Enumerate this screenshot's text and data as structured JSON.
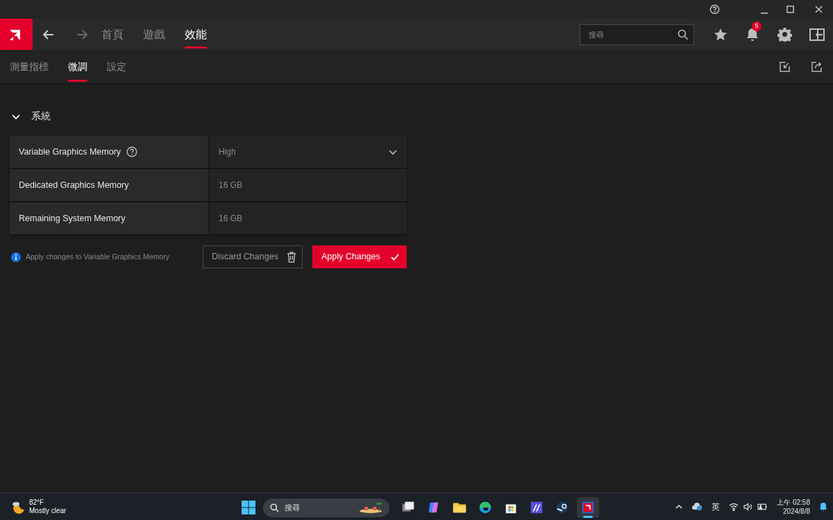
{
  "nav": {
    "tabs": [
      {
        "label": "首頁",
        "selected": false
      },
      {
        "label": "遊戲",
        "selected": false
      },
      {
        "label": "效能",
        "selected": true
      }
    ],
    "search": {
      "placeholder": "搜尋"
    },
    "notification_count": "5"
  },
  "subnav": {
    "tabs": [
      {
        "label": "測量指標",
        "selected": false
      },
      {
        "label": "微調",
        "selected": true
      },
      {
        "label": "設定",
        "selected": false
      }
    ]
  },
  "section": {
    "title": "系統",
    "expanded": true,
    "rows": [
      {
        "kind": "dropdown",
        "label": "Variable Graphics Memory",
        "help": true,
        "value": "High"
      },
      {
        "kind": "readout",
        "label": "Dedicated Graphics Memory",
        "help": false,
        "value": "16 GB"
      },
      {
        "kind": "readout",
        "label": "Remaining System Memory",
        "help": false,
        "value": "16 GB"
      }
    ]
  },
  "info": "Apply changes to Variable Graphics Memory",
  "buttons": [
    {
      "kind": "discard",
      "label": "Discard Changes"
    },
    {
      "kind": "apply",
      "label": "Apply Changes"
    }
  ],
  "taskbar": {
    "weather": {
      "temp": "82°F",
      "condition": "Mostly clear"
    },
    "search": {
      "placeholder": "搜尋"
    },
    "apps": [
      {
        "selected": false
      },
      {
        "selected": false
      },
      {
        "selected": false
      },
      {
        "selected": false
      },
      {
        "selected": false
      },
      {
        "selected": false
      },
      {
        "selected": false
      },
      {
        "selected": true
      }
    ],
    "ime": "英",
    "time": "上午 02:58",
    "date": "2024/8/8"
  }
}
